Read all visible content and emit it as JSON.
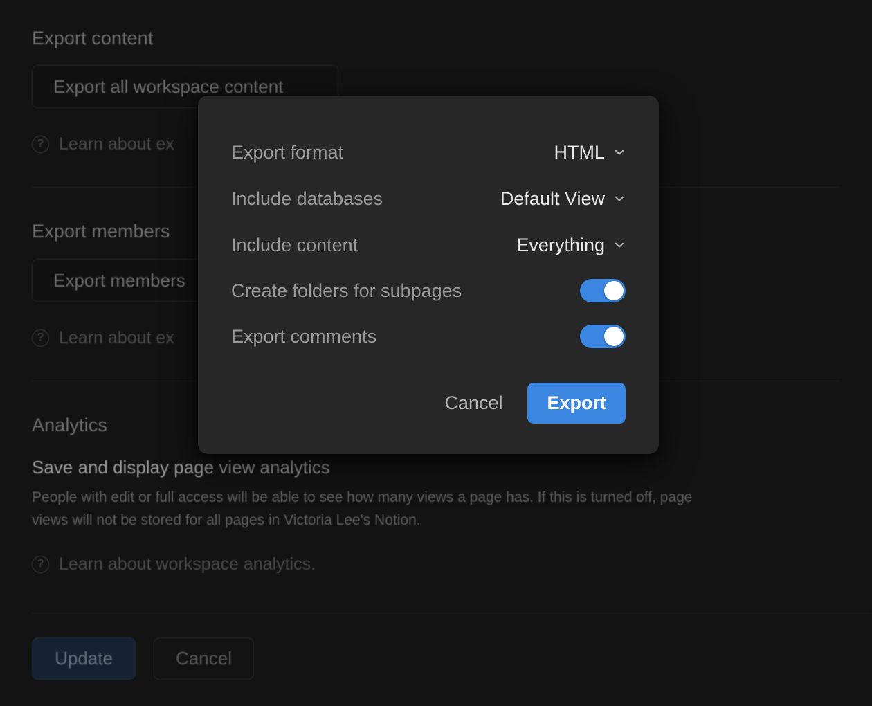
{
  "background": {
    "sections": [
      {
        "title": "Export content",
        "control_label": "Export all workspace content",
        "learn_link": "Learn about ex"
      },
      {
        "title": "Export members",
        "control_label": "Export members",
        "learn_link": "Learn about ex"
      }
    ],
    "analytics": {
      "title": "Analytics",
      "subtitle": "Save and display page view analytics",
      "description": "People with edit or full access will be able to see how many views a page has. If this is turned off, page views will not be stored for all pages in Victoria Lee's Notion.",
      "learn_link": "Learn about workspace analytics."
    },
    "footer": {
      "update_label": "Update",
      "cancel_label": "Cancel"
    },
    "help_icon": "question-circle-icon"
  },
  "modal": {
    "rows": [
      {
        "label": "Export format",
        "value": "HTML",
        "type": "select",
        "icon": "chevron-down-icon"
      },
      {
        "label": "Include databases",
        "value": "Default View",
        "type": "select",
        "icon": "chevron-down-icon"
      },
      {
        "label": "Include content",
        "value": "Everything",
        "type": "select",
        "icon": "chevron-down-icon"
      }
    ],
    "toggles": [
      {
        "label": "Create folders for subpages",
        "state": "on"
      },
      {
        "label": "Export comments",
        "state": "on"
      }
    ],
    "cancel_label": "Cancel",
    "export_label": "Export"
  },
  "colors": {
    "accent": "#3a86e0",
    "page_bg": "#131313",
    "modal_bg": "#272727",
    "label_text": "#9a9a9a",
    "value_text": "#e9e9e9",
    "update_btn_bg": "#1a2c43"
  }
}
